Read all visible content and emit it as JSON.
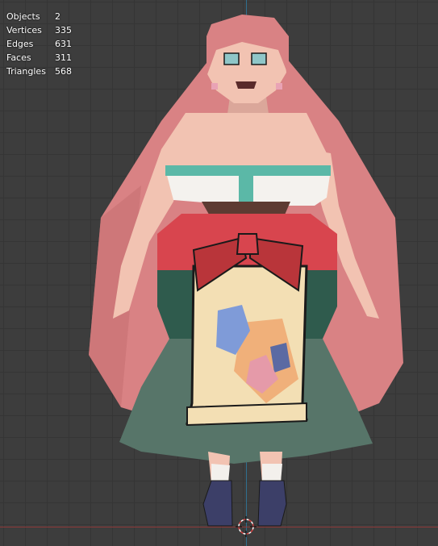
{
  "viewport": {
    "background": "#3d3d3d",
    "grid_color": "#353535",
    "y_axis_color": "#2f6f8f",
    "x_axis_color": "#8f3a3a",
    "origin_cursor_icon": "3d-cursor-icon"
  },
  "statistics": [
    {
      "label": "Objects",
      "value": "2"
    },
    {
      "label": "Vertices",
      "value": "335"
    },
    {
      "label": "Edges",
      "value": "631"
    },
    {
      "label": "Faces",
      "value": "311"
    },
    {
      "label": "Triangles",
      "value": "568"
    }
  ],
  "model": {
    "colors": {
      "hair": "#d98284",
      "hair_dark": "#c66f72",
      "skin": "#f2c3b2",
      "skin_shadow": "#dba79a",
      "top_white": "#f4f2ee",
      "top_teal": "#5bb8a7",
      "waist_brown": "#5d3b32",
      "band_red": "#d8454e",
      "skirt_dark_green": "#2f5b4d",
      "skirt_green": "#577569",
      "apron_cream": "#f3dfb4",
      "apron_orange": "#f0b07a",
      "bow_red": "#b9353a",
      "flower_blue": "#7f9bd8",
      "flower_pink": "#e59aa9",
      "shoe_navy": "#3c3f68",
      "sock_white": "#f3f0ec"
    }
  }
}
